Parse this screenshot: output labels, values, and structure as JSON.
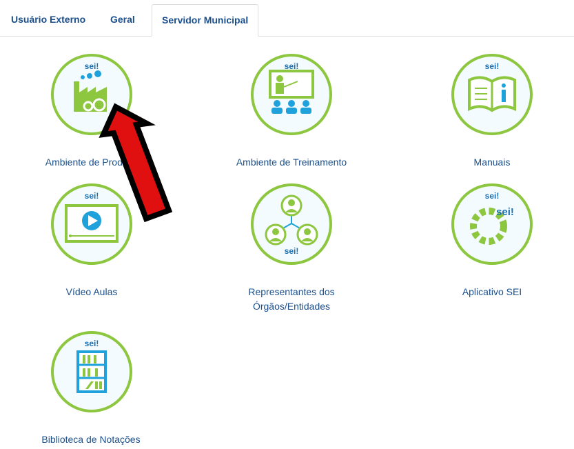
{
  "tabs": [
    {
      "label": "Usuário Externo"
    },
    {
      "label": "Geral"
    },
    {
      "label": "Servidor Municipal"
    }
  ],
  "brand": "sei!",
  "items": [
    {
      "label": "Ambiente de Produção",
      "icon": "factory-gears-icon"
    },
    {
      "label": "Ambiente de Treinamento",
      "icon": "presentation-training-icon"
    },
    {
      "label": "Manuais",
      "icon": "manual-book-icon"
    },
    {
      "label": "Vídeo Aulas",
      "icon": "video-play-icon"
    },
    {
      "label_line1": "Representantes dos",
      "label_line2": "Órgãos/Entidades",
      "icon": "people-network-icon"
    },
    {
      "label": "Aplicativo SEI",
      "icon": "gear-app-icon"
    },
    {
      "label": "Biblioteca de Notações",
      "icon": "bookshelf-icon"
    }
  ],
  "colors": {
    "ring": "#8dc63f",
    "accent": "#1fa2dc",
    "link": "#1b4f8c",
    "arrow_fill": "#e01010",
    "arrow_outline": "#000000"
  }
}
